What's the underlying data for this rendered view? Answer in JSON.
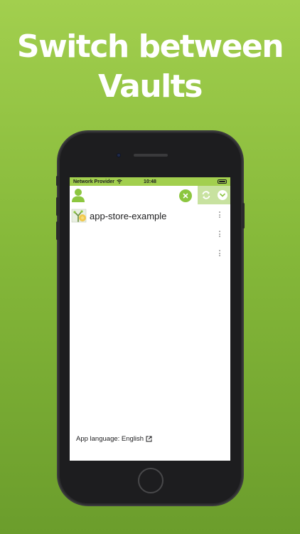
{
  "headline": {
    "line1": "Switch between",
    "line2": "Vaults"
  },
  "status_bar": {
    "carrier": "Network Provider",
    "time": "10:48"
  },
  "app_bar": {
    "icons": [
      "user-icon",
      "close-icon",
      "sync-icon",
      "chevron-down-icon"
    ]
  },
  "vaults": [
    {
      "name": "app-store-example"
    }
  ],
  "footer": {
    "language_label": "App language: English"
  },
  "colors": {
    "background": "#8cc63f",
    "accent": "#8cc63f",
    "action_panel": "#c8e2a0"
  }
}
